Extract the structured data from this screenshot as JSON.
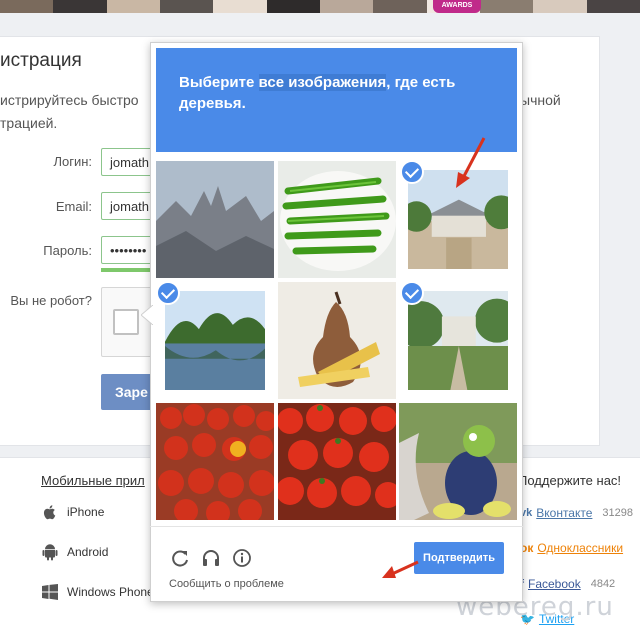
{
  "awards_badge": "AWARDS",
  "registration": {
    "title": "истрация",
    "subtitle_line1": "истрируйтесь быстро",
    "subtitle_line2": "трацией.",
    "subtitle_right": "ычной",
    "fields": [
      {
        "label": "Логин:",
        "value": "jomath"
      },
      {
        "label": "Email:",
        "value": "jomath"
      },
      {
        "label": "Пароль:",
        "value": "••••••••"
      }
    ],
    "robot_label": "Вы не робот?",
    "register_button": "Заре"
  },
  "captcha": {
    "instruction_pre": "Выберите ",
    "instruction_highlight": "все изображения",
    "instruction_post": ", где есть деревья.",
    "tiles": [
      {
        "name": "mountains",
        "selected": false
      },
      {
        "name": "green-beans",
        "selected": false
      },
      {
        "name": "house-trees",
        "selected": true
      },
      {
        "name": "lake-trees",
        "selected": true
      },
      {
        "name": "pear-dessert",
        "selected": false
      },
      {
        "name": "garden-trees",
        "selected": true
      },
      {
        "name": "tomatoes-market",
        "selected": false
      },
      {
        "name": "tomatoes-crate",
        "selected": false
      },
      {
        "name": "toy-frog",
        "selected": false
      }
    ],
    "tools": [
      "reload-icon",
      "audio-icon",
      "info-icon"
    ],
    "report_problem": "Сообщить о проблеме",
    "verify_button": "Подтвердить",
    "accent_color": "#4a8ae8"
  },
  "footer": {
    "mobile_title": "Мобильные прил",
    "os_items": [
      {
        "icon": "apple-icon",
        "label": "iPhone"
      },
      {
        "icon": "android-icon",
        "label": "Android"
      },
      {
        "icon": "windows-icon",
        "label": "Windows Phone"
      }
    ],
    "support_title": "Поддержите нас!",
    "social": [
      {
        "icon": "vk-icon",
        "label": "Вконтакте",
        "count": "31298",
        "color": "#4a76a8"
      },
      {
        "icon": "ok-icon",
        "label": "Одноклассники",
        "count": "",
        "color": "#ee8208"
      },
      {
        "icon": "facebook-icon",
        "label": "Facebook",
        "count": "4842",
        "color": "#3b5998"
      },
      {
        "icon": "twitter-icon",
        "label": "Twitter",
        "count": "",
        "color": "#1da1f2"
      }
    ],
    "watermark": "webereg.ru"
  }
}
